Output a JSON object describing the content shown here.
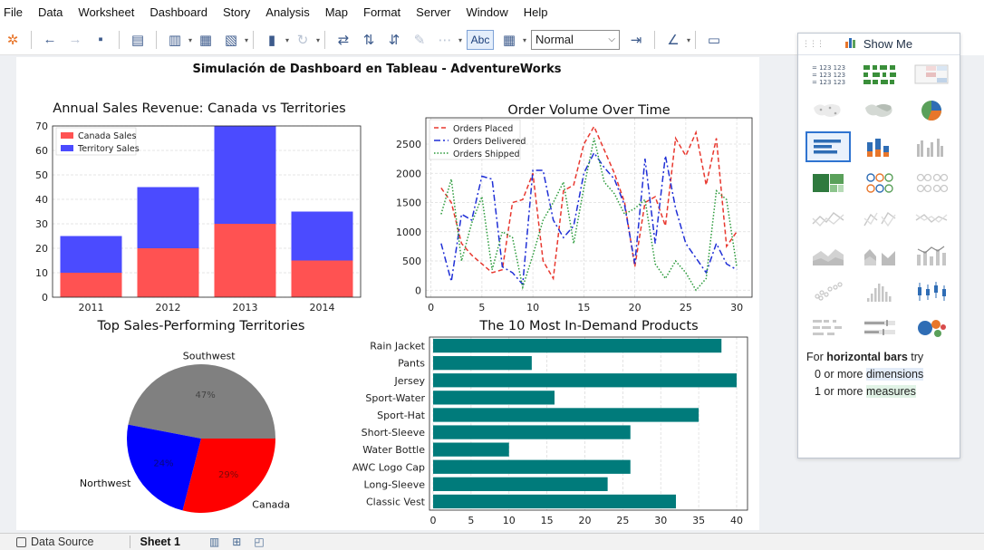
{
  "menu": [
    "File",
    "Data",
    "Worksheet",
    "Dashboard",
    "Story",
    "Analysis",
    "Map",
    "Format",
    "Server",
    "Window",
    "Help"
  ],
  "toolbar": {
    "abc_label": "Abc",
    "fit_value": "Normal"
  },
  "dashboard": {
    "title": "Simulación de Dashboard en Tableau - AdventureWorks"
  },
  "showme": {
    "title": "Show Me",
    "hint_prefix": "For ",
    "hint_bold": "horizontal bars",
    "hint_suffix": " try",
    "line1_prefix": "0 or more ",
    "line1_highlight": "dimensions",
    "line2_prefix": "1 or more ",
    "line2_highlight": "measures",
    "table_text": "123 123"
  },
  "status": {
    "data_source": "Data Source",
    "sheet": "Sheet 1"
  },
  "chart_data": [
    {
      "type": "bar",
      "title": "Annual Sales Revenue: Canada vs Territories",
      "categories": [
        "2011",
        "2012",
        "2013",
        "2014"
      ],
      "series": [
        {
          "name": "Canada Sales",
          "values": [
            10,
            20,
            30,
            15
          ],
          "color": "#ff5252"
        },
        {
          "name": "Territory Sales",
          "values": [
            15,
            25,
            40,
            20
          ],
          "color": "#4b4bff"
        }
      ],
      "stacked": true,
      "ylim": [
        0,
        70
      ],
      "yticks": [
        0,
        10,
        20,
        30,
        40,
        50,
        60,
        70
      ],
      "legend": "top-left",
      "grid": true
    },
    {
      "type": "line",
      "title": "Order Volume Over Time",
      "x": [
        1,
        2,
        3,
        4,
        5,
        6,
        7,
        8,
        9,
        10,
        11,
        12,
        13,
        14,
        15,
        16,
        17,
        18,
        19,
        20,
        21,
        22,
        23,
        24,
        25,
        26,
        27,
        28,
        29,
        30
      ],
      "series": [
        {
          "name": "Orders Placed",
          "style": "dashed",
          "color": "#e8382f",
          "values": [
            1750,
            1500,
            800,
            600,
            450,
            300,
            350,
            1500,
            1550,
            2000,
            500,
            200,
            1700,
            1800,
            2500,
            2800,
            2400,
            2000,
            1500,
            400,
            1500,
            1600,
            1100,
            2600,
            2300,
            2700,
            1800,
            2600,
            750,
            1000
          ]
        },
        {
          "name": "Orders Delivered",
          "style": "dashdot",
          "color": "#1f2fd6",
          "values": [
            800,
            150,
            1300,
            1200,
            1950,
            1900,
            400,
            300,
            100,
            2050,
            2050,
            1200,
            900,
            1100,
            2000,
            2350,
            2100,
            1900,
            1450,
            450,
            2250,
            800,
            2300,
            1400,
            800,
            550,
            300,
            800,
            450,
            350
          ]
        },
        {
          "name": "Orders Shipped",
          "style": "dotted",
          "color": "#2a9a3a",
          "values": [
            1300,
            1900,
            500,
            1150,
            1600,
            350,
            1000,
            900,
            50,
            600,
            1200,
            1500,
            1850,
            800,
            1750,
            2600,
            1850,
            1650,
            1300,
            1400,
            1550,
            450,
            200,
            500,
            300,
            0,
            200,
            1700,
            1550,
            400
          ]
        }
      ],
      "xticks": [
        0,
        5,
        10,
        15,
        20,
        25,
        30
      ],
      "yticks": [
        0,
        500,
        1000,
        1500,
        2000,
        2500
      ],
      "legend": "top-left",
      "grid": true
    },
    {
      "type": "pie",
      "title": "Top Sales-Performing Territories",
      "slices": [
        {
          "label": "Southwest",
          "value": 47,
          "pct": "47%",
          "color": "#808080"
        },
        {
          "label": "Northwest",
          "value": 24,
          "pct": "24%",
          "color": "#0000ff"
        },
        {
          "label": "Canada",
          "value": 29,
          "pct": "29%",
          "color": "#ff0000"
        }
      ]
    },
    {
      "type": "bar",
      "orientation": "horizontal",
      "title": "The 10 Most In-Demand Products",
      "categories": [
        "Rain Jacket",
        "Pants",
        "Jersey",
        "Sport-Water",
        "Sport-Hat",
        "Short-Sleeve",
        "Water Bottle",
        "AWC Logo Cap",
        "Long-Sleeve",
        "Classic Vest"
      ],
      "values": [
        38,
        13,
        40,
        16,
        35,
        26,
        10,
        26,
        23,
        32
      ],
      "color": "#007b7b",
      "xticks": [
        0,
        5,
        10,
        15,
        20,
        25,
        30,
        35,
        40
      ],
      "xlim": [
        0,
        40
      ],
      "grid": true
    }
  ]
}
